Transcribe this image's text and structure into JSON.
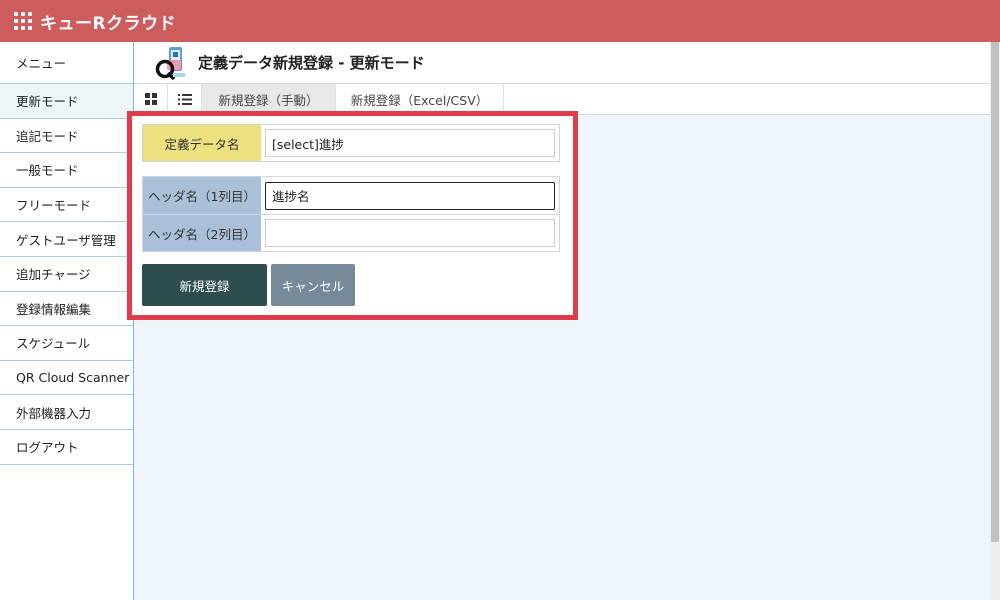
{
  "app": {
    "title": "キューRクラウド",
    "icon": "grid-icon"
  },
  "sidebar": {
    "items": [
      {
        "label": "メニュー"
      },
      {
        "label": "更新モード",
        "active": true
      },
      {
        "label": "追記モード"
      },
      {
        "label": "一般モード"
      },
      {
        "label": "フリーモード"
      },
      {
        "label": "ゲストユーザ管理"
      },
      {
        "label": "追加チャージ"
      },
      {
        "label": "登録情報編集"
      },
      {
        "label": "スケジュール"
      },
      {
        "label": "QR Cloud Scanner"
      },
      {
        "label": "外部機器入力"
      },
      {
        "label": "ログアウト"
      }
    ]
  },
  "header": {
    "title": "定義データ新規登録 - 更新モード",
    "icon": "update-mode-logo-icon"
  },
  "tabs": {
    "view_buttons": [
      "tile-view-icon",
      "list-view-icon"
    ],
    "items": [
      {
        "label": "新規登録（手動）",
        "active": true
      },
      {
        "label": "新規登録（Excel/CSV）",
        "active": false
      }
    ]
  },
  "form": {
    "definition": {
      "label": "定義データ名",
      "value": "[select]進捗"
    },
    "header1": {
      "label": "ヘッダ名（1列目）",
      "value": "進捗名"
    },
    "header2": {
      "label": "ヘッダ名（2列目）",
      "value": ""
    },
    "submit_label": "新規登録",
    "cancel_label": "キャンセル"
  },
  "colors": {
    "topbar": "#cd5c5c",
    "highlight_frame": "#e03c4e",
    "label_yellow": "#ece07f",
    "label_blue": "#a9c0d8",
    "primary_button": "#2e4e4e",
    "cancel_button": "#778a9a"
  }
}
